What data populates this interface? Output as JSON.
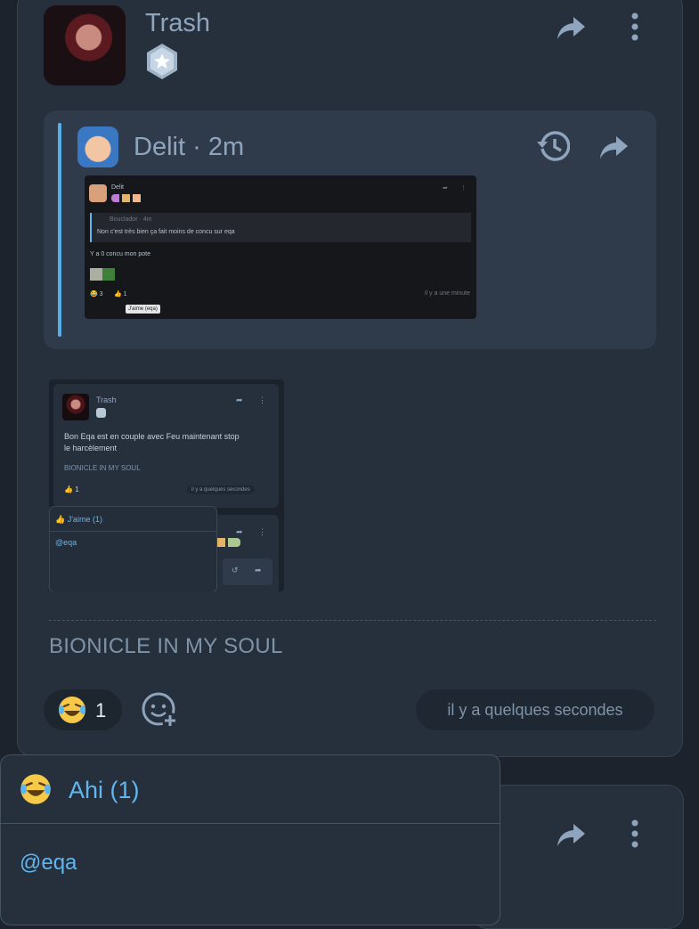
{
  "post": {
    "author": "Trash",
    "signature": "BIONICLE IN MY SOUL",
    "timestamp": "il y a quelques secondes",
    "reaction_count": "1"
  },
  "quote": {
    "author": "Delit",
    "separator": "·",
    "time": "2m"
  },
  "screenshot1": {
    "author": "Delit",
    "inner_author": "Bouclador",
    "inner_time": "4m",
    "inner_text": "Non c'est très bien ça fait moins de concu sur eqa",
    "text": "Y a 0 concu mon pote",
    "reaction1": "3",
    "reaction2": "1",
    "tooltip": "J'aime (eqa)",
    "time": "il y a une minute"
  },
  "screenshot2": {
    "author": "Trash",
    "text_line1": "Bon Eqa est en couple avec Feu maintenant stop",
    "text_line2": "le harcèlement",
    "signature": "BIONICLE IN MY SOUL",
    "reaction_count": "1",
    "time": "il y a quelques secondes",
    "popup_title": "J'aime (1)",
    "popup_user": "@eqa"
  },
  "popup": {
    "title": "Ahi (1)",
    "user": "@eqa"
  },
  "colors": {
    "accent": "#5fb6f0",
    "card": "#26303c",
    "background": "#1c232c"
  }
}
